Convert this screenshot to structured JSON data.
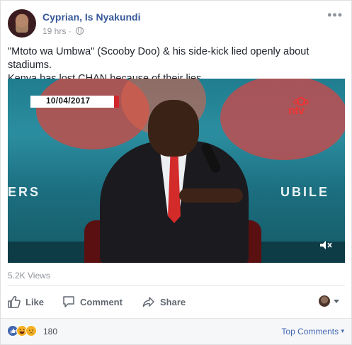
{
  "post": {
    "author": "Cyprian, Is Nyakundi",
    "time": "19 hrs",
    "separator": "·",
    "more_label": "•••",
    "text_line1": "\"Mtoto wa Umbwa\" (Scooby Doo) & his side-kick lied openly about stadiums.",
    "text_line2": "Kenya has lost CHAN because of their lies."
  },
  "video": {
    "date_overlay": "10/04/2017",
    "channel_logo": "ntv",
    "banner_left": "ERS",
    "banner_right": "UBILE",
    "volume_icon": "volume-muted-icon"
  },
  "stats": {
    "views": "5.2K Views"
  },
  "actions": {
    "like": "Like",
    "comment": "Comment",
    "share": "Share"
  },
  "reactions": {
    "count": "180",
    "top_comments": "Top Comments",
    "types": [
      "like",
      "haha",
      "sad"
    ]
  },
  "colors": {
    "link": "#365899",
    "like_blue": "#4267b2",
    "muted": "#90949c",
    "ntv_red": "#e33333"
  }
}
